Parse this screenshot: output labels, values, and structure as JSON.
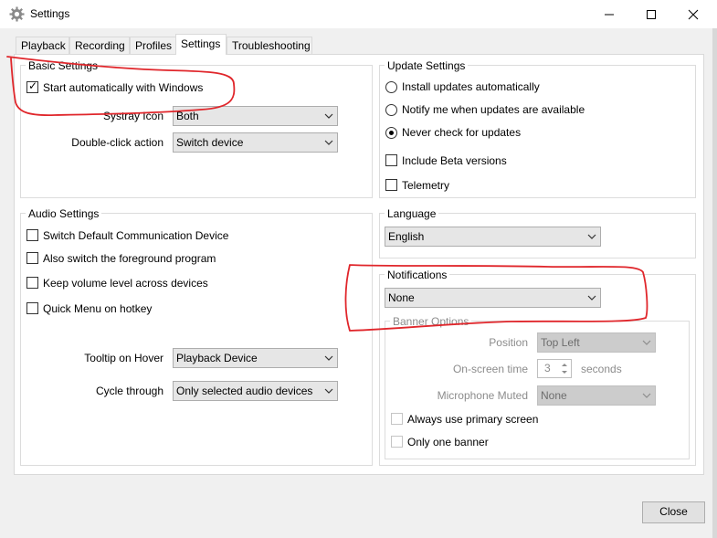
{
  "window": {
    "title": "Settings",
    "icons": {
      "app": "gear-icon",
      "minimize": "minimize-icon",
      "maximize": "maximize-icon",
      "close": "close-icon"
    }
  },
  "tabs": [
    {
      "label": "Playback"
    },
    {
      "label": "Recording"
    },
    {
      "label": "Profiles"
    },
    {
      "label": "Settings",
      "active": true
    },
    {
      "label": "Troubleshooting"
    }
  ],
  "basic": {
    "title": "Basic Settings",
    "start_with_windows": {
      "label": "Start automatically with Windows",
      "checked": true
    },
    "systray_label": "Systray Icon",
    "systray_value": "Both",
    "double_click_label": "Double-click action",
    "double_click_value": "Switch device"
  },
  "update": {
    "title": "Update Settings",
    "options": [
      {
        "label": "Install updates automatically",
        "selected": false
      },
      {
        "label": "Notify me when updates are available",
        "selected": false
      },
      {
        "label": "Never check for updates",
        "selected": true
      }
    ],
    "beta_label": "Include Beta versions",
    "telemetry_label": "Telemetry"
  },
  "audio": {
    "title": "Audio Settings",
    "checks": [
      {
        "label": "Switch Default Communication Device",
        "checked": false
      },
      {
        "label": "Also switch the foreground program",
        "checked": false
      },
      {
        "label": "Keep volume level across devices",
        "checked": false
      },
      {
        "label": "Quick Menu on hotkey",
        "checked": false
      }
    ],
    "tooltip_label": "Tooltip on Hover",
    "tooltip_value": "Playback Device",
    "cycle_label": "Cycle through",
    "cycle_value": "Only selected audio devices"
  },
  "language": {
    "title": "Language",
    "value": "English"
  },
  "notifications": {
    "title": "Notifications",
    "value": "None",
    "banner": {
      "title": "Banner Options",
      "position_label": "Position",
      "position_value": "Top Left",
      "onscreen_label": "On-screen time",
      "onscreen_value": "3",
      "onscreen_unit": "seconds",
      "mic_label": "Microphone Muted",
      "mic_value": "None",
      "primary_label": "Always use primary screen",
      "one_banner_label": "Only one banner"
    }
  },
  "footer": {
    "close_label": "Close"
  },
  "colors": {
    "annotation": "#e0262b",
    "tab_border": "#d9d9d9"
  }
}
